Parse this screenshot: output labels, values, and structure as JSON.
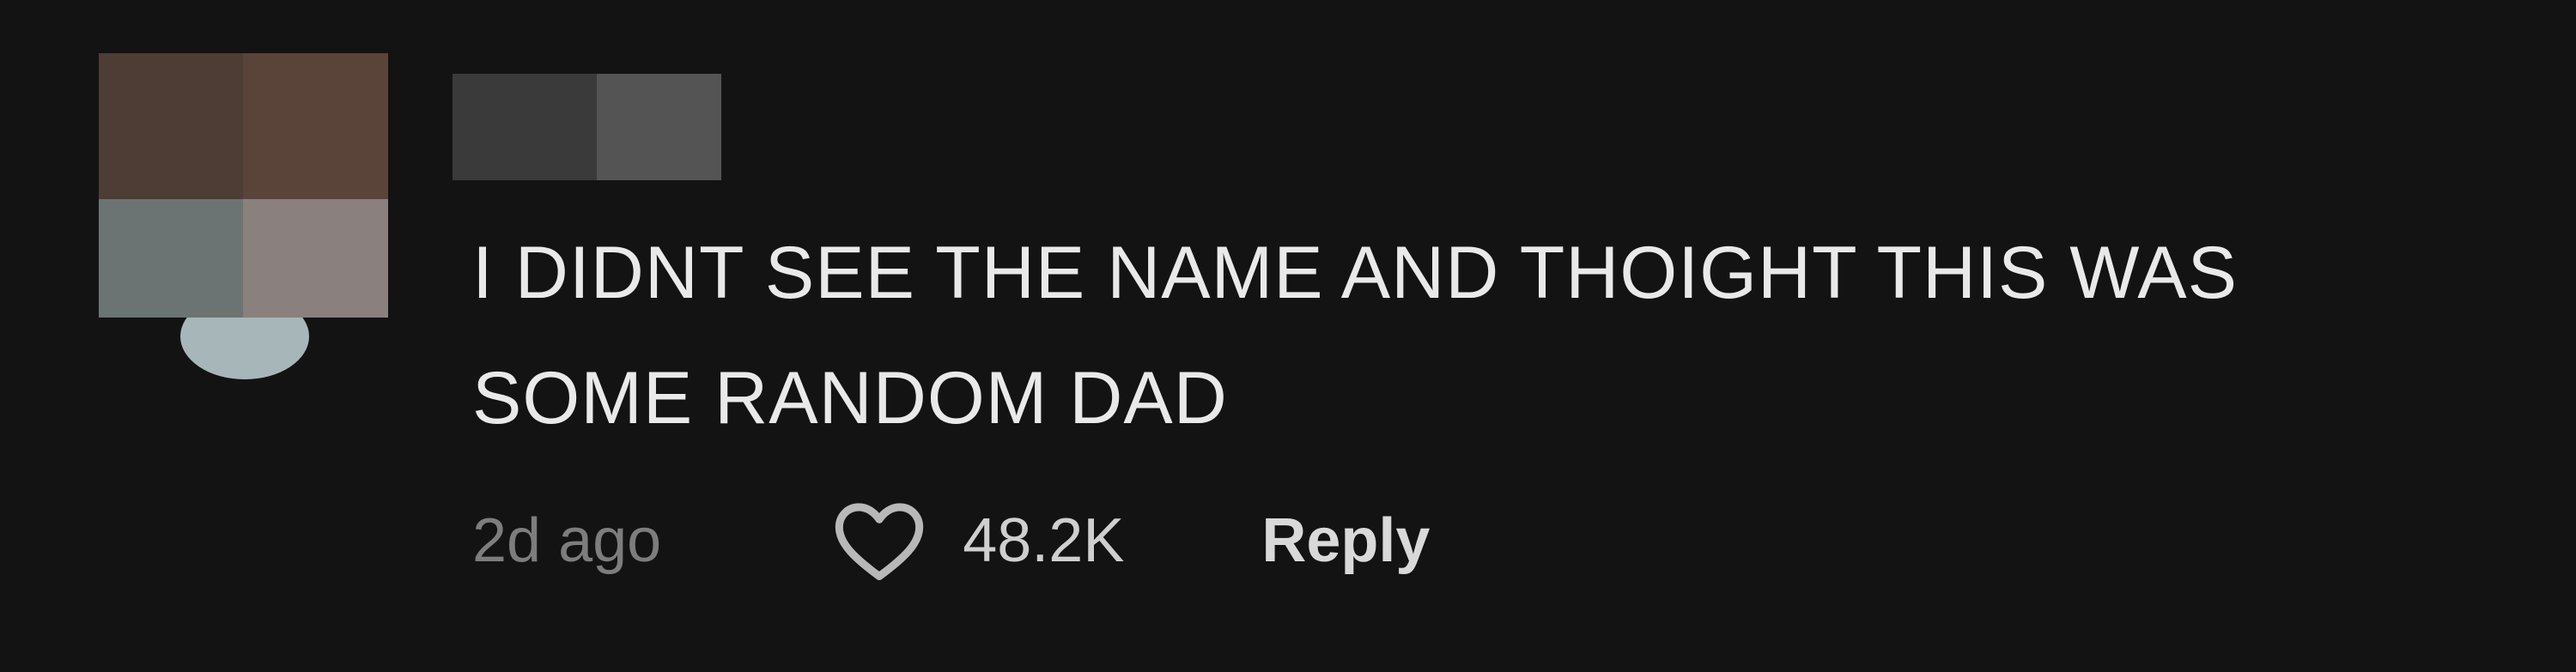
{
  "comment": {
    "avatar_pixels": [
      "#4e3d34",
      "#5a4439",
      "#6b7472",
      "#8a807e"
    ],
    "username_pixels": [
      "#3a3a3a",
      "#545454"
    ],
    "text": "I DIDNT SEE THE NAME AND THOIGHT THIS WAS\nSOME RANDOM DAD",
    "timestamp": "2d ago",
    "like_icon": "heart-outline-icon",
    "like_count": "48.2K",
    "reply_label": "Reply"
  },
  "colors": {
    "background": "#131313",
    "text": "#e9e9e9",
    "muted": "#7d7d7d"
  }
}
